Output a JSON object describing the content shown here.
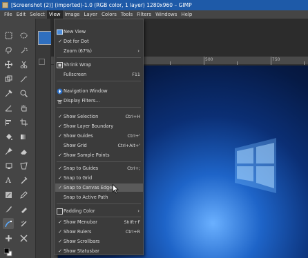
{
  "window": {
    "title": "[Screenshot (2)] (imported)-1.0 (RGB color, 1 layer) 1280x960 – GIMP"
  },
  "menubar": [
    "File",
    "Edit",
    "Select",
    "View",
    "Image",
    "Layer",
    "Colors",
    "Tools",
    "Filters",
    "Windows",
    "Help"
  ],
  "ruler": {
    "h_labels": [
      "500",
      "750"
    ]
  },
  "view_menu": {
    "items": [
      {
        "label": "New View",
        "icon": "new-view-icon"
      },
      {
        "label": "Dot for Dot",
        "check": "✓"
      },
      {
        "label": "Zoom (67%)",
        "arrow": "›"
      },
      {
        "label": "Shrink Wrap",
        "icon": "shrink-wrap-icon"
      },
      {
        "label": "Fullscreen",
        "shortcut": "F11"
      },
      {
        "label": "Navigation Window",
        "icon": "navigation-icon"
      },
      {
        "label": "Display Filters...",
        "icon": "display-filters-icon"
      },
      {
        "label": "Show Selection",
        "check": "✓",
        "shortcut": "Ctrl+H"
      },
      {
        "label": "Show Layer Boundary",
        "check": "✓"
      },
      {
        "label": "Show Guides",
        "check": "✓",
        "shortcut": "Ctrl+'"
      },
      {
        "label": "Show Grid",
        "shortcut": "Ctrl+Alt+'"
      },
      {
        "label": "Show Sample Points",
        "check": "✓"
      },
      {
        "label": "Snap to Guides",
        "check": "✓",
        "shortcut": "Ctrl+;"
      },
      {
        "label": "Snap to Grid",
        "check": "✓"
      },
      {
        "label": "Snap to Canvas Edges",
        "check": "✓"
      },
      {
        "label": "Snap to Active Path"
      },
      {
        "label": "Padding Color",
        "arrow": "›",
        "icon": "padding-color-icon"
      },
      {
        "label": "Show Menubar",
        "check": "✓",
        "shortcut": "Shift+F"
      },
      {
        "label": "Show Rulers",
        "check": "✓",
        "shortcut": "Ctrl+R"
      },
      {
        "label": "Show Scrollbars",
        "check": "✓"
      },
      {
        "label": "Show Statusbar",
        "check": "✓"
      }
    ]
  }
}
